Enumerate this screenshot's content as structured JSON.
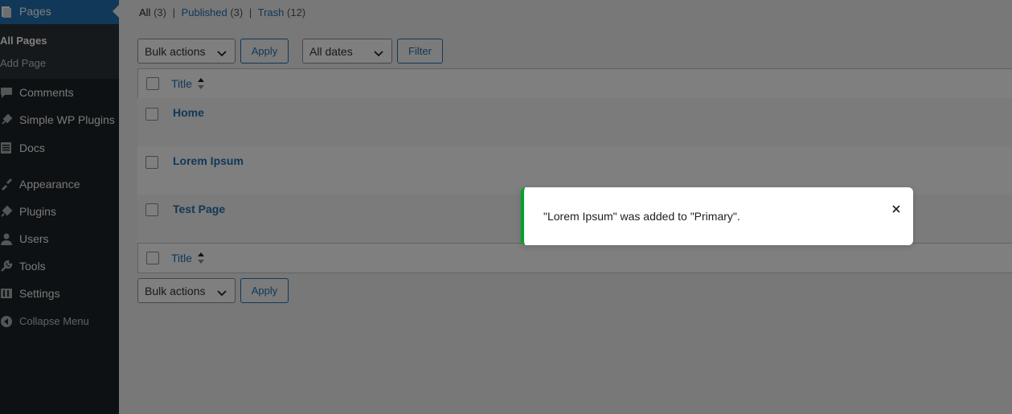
{
  "sidebar": {
    "current_menu": {
      "label": "Pages",
      "icon": "pages-icon"
    },
    "submenu": [
      {
        "label": "All Pages",
        "current": true
      },
      {
        "label": "Add Page",
        "current": false
      }
    ],
    "items": [
      {
        "label": "Comments",
        "icon": "comments-icon"
      },
      {
        "label": "Simple WP Plugins",
        "icon": "plugin-icon"
      },
      {
        "label": "Docs",
        "icon": "docs-icon"
      },
      {
        "label": "Appearance",
        "icon": "appearance-icon"
      },
      {
        "label": "Plugins",
        "icon": "plugins-icon"
      },
      {
        "label": "Users",
        "icon": "users-icon"
      },
      {
        "label": "Tools",
        "icon": "tools-icon"
      },
      {
        "label": "Settings",
        "icon": "settings-icon"
      },
      {
        "label": "Collapse Menu",
        "icon": "collapse-icon"
      }
    ]
  },
  "filters": {
    "all_label": "All",
    "all_count": "(3)",
    "published_label": "Published",
    "published_count": "(3)",
    "trash_label": "Trash",
    "trash_count": "(12)",
    "separator": "|"
  },
  "toolbar_top": {
    "bulk_actions": "Bulk actions",
    "apply": "Apply",
    "dates": "All dates",
    "filter": "Filter"
  },
  "table": {
    "column_title": "Title",
    "rows": [
      {
        "title": "Home"
      },
      {
        "title": "Lorem Ipsum"
      },
      {
        "title": "Test Page"
      }
    ]
  },
  "toolbar_bottom": {
    "bulk_actions": "Bulk actions",
    "apply": "Apply"
  },
  "toast": {
    "message": "\"Lorem Ipsum\" was added to \"Primary\".",
    "accent_color": "#00a32a"
  },
  "colors": {
    "sidebar_bg": "#1d2327",
    "accent": "#2271b1",
    "overlay": "rgba(0,0,0,0.5)"
  }
}
